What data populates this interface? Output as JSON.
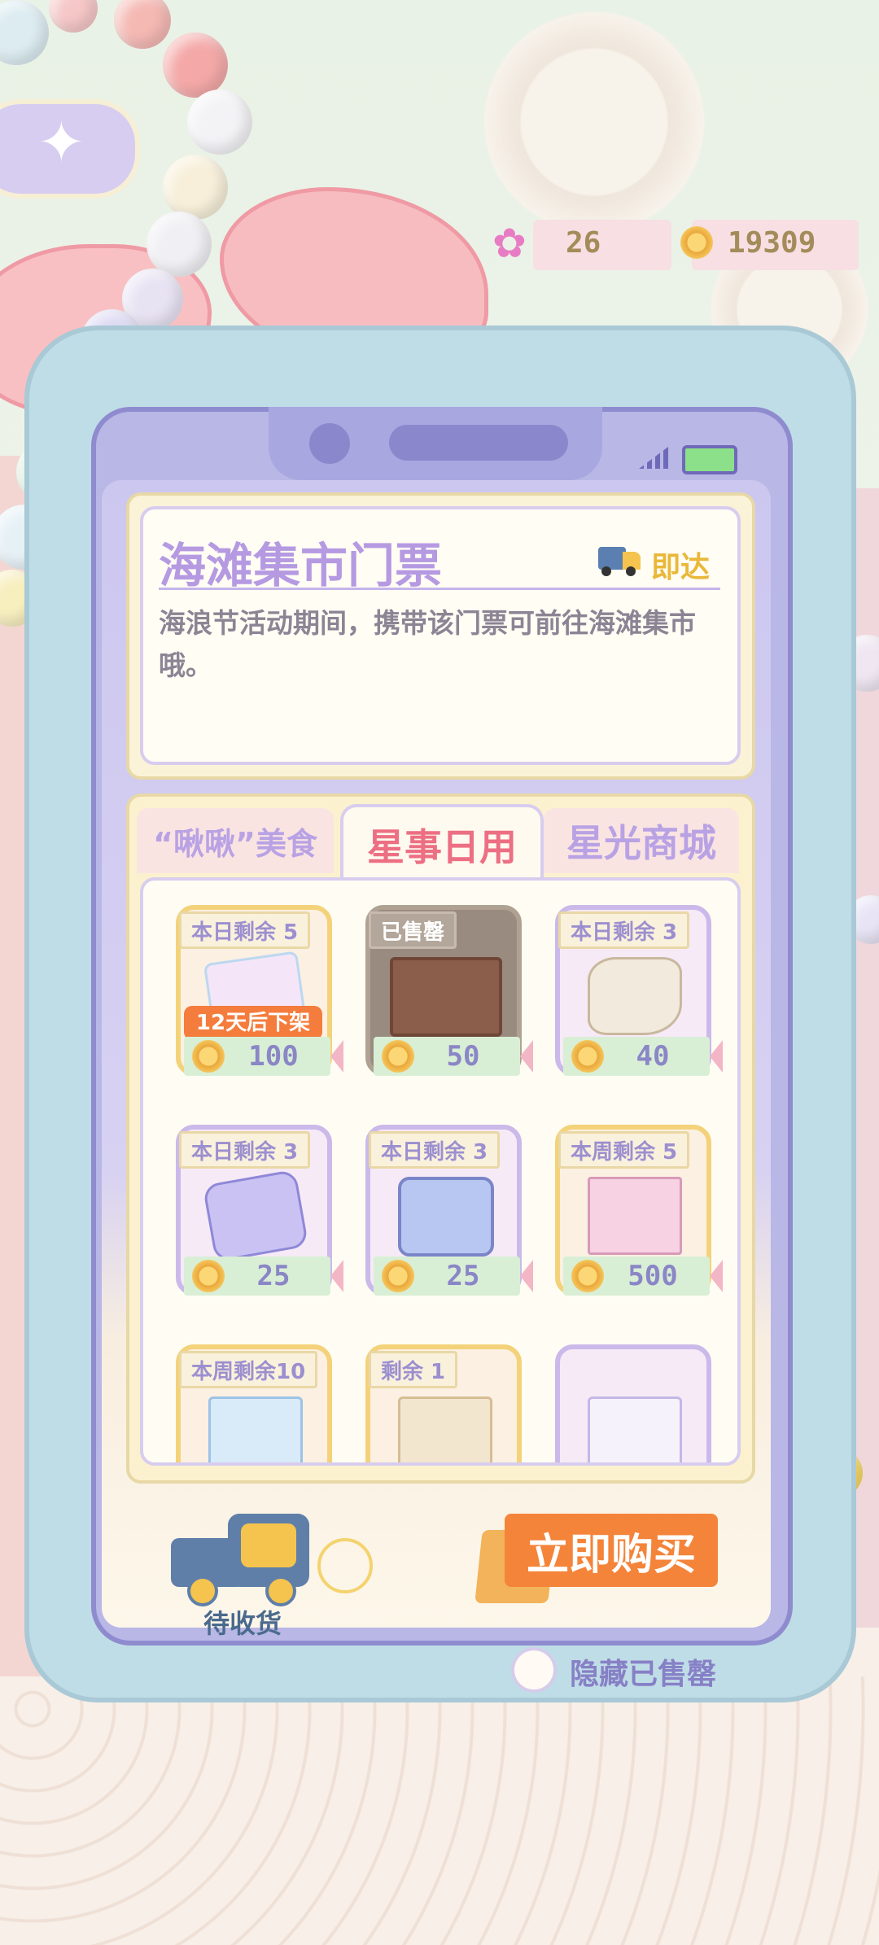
{
  "currency": {
    "gems": "26",
    "coins": "19309"
  },
  "ticket": {
    "title": "海滩集市门票",
    "delivery_label": "即达",
    "description": "海浪节活动期间，携带该门票可前往海滩集市哦。"
  },
  "tabs": [
    {
      "label": "“啾啾”美食"
    },
    {
      "label": "星事日用"
    },
    {
      "label": "星光商城"
    }
  ],
  "items": [
    {
      "tag": "本日剩余 5",
      "price": "100",
      "badge": "12天后下架"
    },
    {
      "tag": "已售罄",
      "price": "50"
    },
    {
      "tag": "本日剩余 3",
      "price": "40"
    },
    {
      "tag": "本日剩余 3",
      "price": "25"
    },
    {
      "tag": "本日剩余 3",
      "price": "25"
    },
    {
      "tag": "本周剩余 5",
      "price": "500"
    },
    {
      "tag": "本周剩余10"
    },
    {
      "tag": "剩余 1"
    },
    {
      "tag": ""
    }
  ],
  "footer": {
    "pending_label": "待收货",
    "buy_label": "立即购买",
    "hide_sold_label": "隐藏已售罄"
  },
  "colors": {
    "accent_purple": "#b59ae2",
    "buy_button": "#f4843a",
    "tab_active_text": "#ec6f83"
  }
}
